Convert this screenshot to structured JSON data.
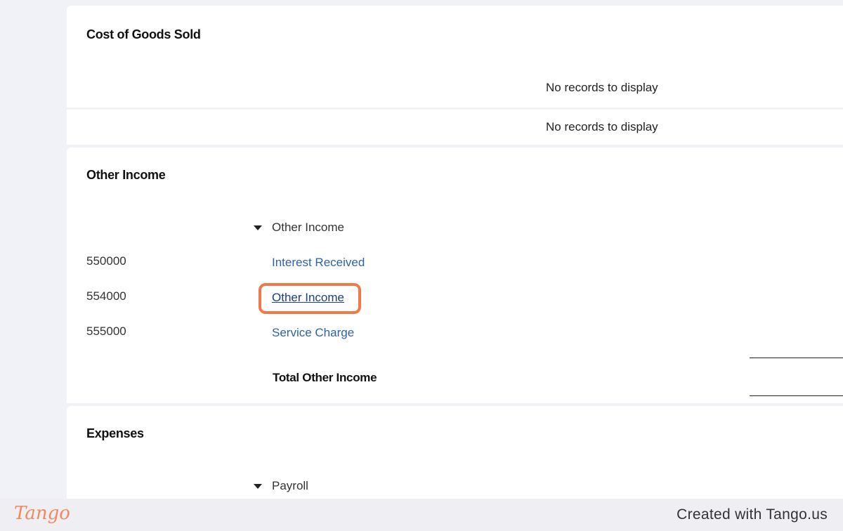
{
  "sections": {
    "cost_of_goods_sold": {
      "title": "Cost of Goods Sold",
      "empty_message": "No records to display",
      "footer_empty_message": "No records to display"
    },
    "other_income": {
      "title": "Other Income",
      "group_label": "Other Income",
      "rows": [
        {
          "account": "550000",
          "name": "Interest Received"
        },
        {
          "account": "554000",
          "name": "Other Income"
        },
        {
          "account": "555000",
          "name": "Service Charge"
        }
      ],
      "total_label": "Total Other Income"
    },
    "expenses": {
      "title": "Expenses",
      "group_label": "Payroll"
    }
  },
  "footer": {
    "logo": "Tango",
    "credit": "Created with Tango.us",
    "logo_color": "#f08a5c"
  },
  "highlight_color": "#f07a47",
  "link_color": "#2b63a8"
}
